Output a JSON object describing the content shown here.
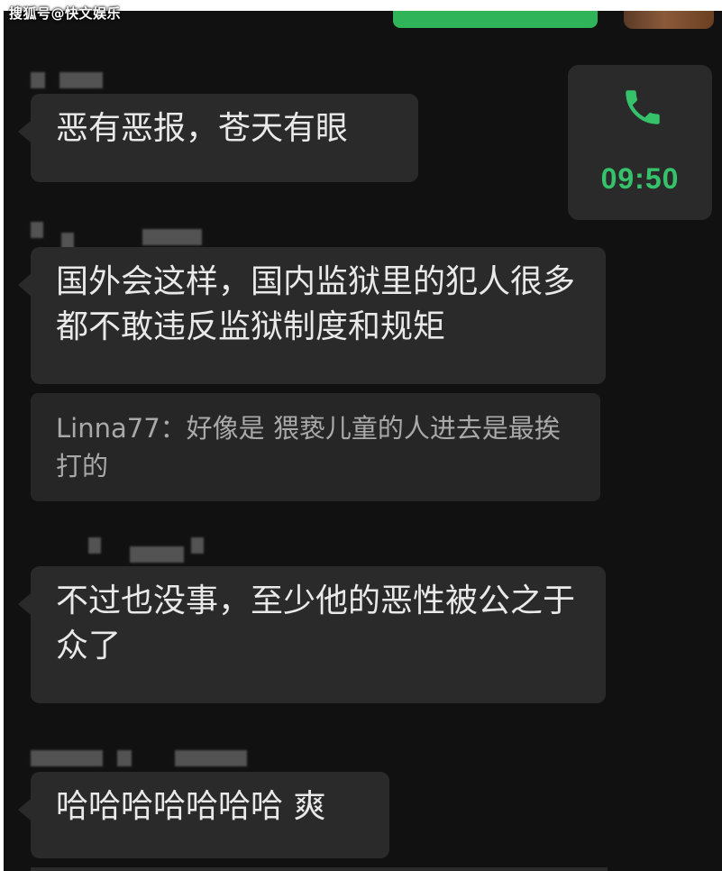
{
  "watermark": "搜狐号@快文娱乐",
  "call": {
    "time": "09:50",
    "icon": "phone-icon",
    "accent_color": "#35c26a"
  },
  "messages": [
    {
      "text": "恶有恶报，苍天有眼"
    },
    {
      "text": "国外会这样，国内监狱里的犯人很多都不敢违反监狱制度和规矩"
    },
    {
      "text": "不过也没事，至少他的恶性被公之于众了"
    },
    {
      "text": "哈哈哈哈哈哈哈 爽"
    }
  ],
  "quote": {
    "text": "Linna77：好像是 猥亵儿童的人进去是最挨打的"
  }
}
